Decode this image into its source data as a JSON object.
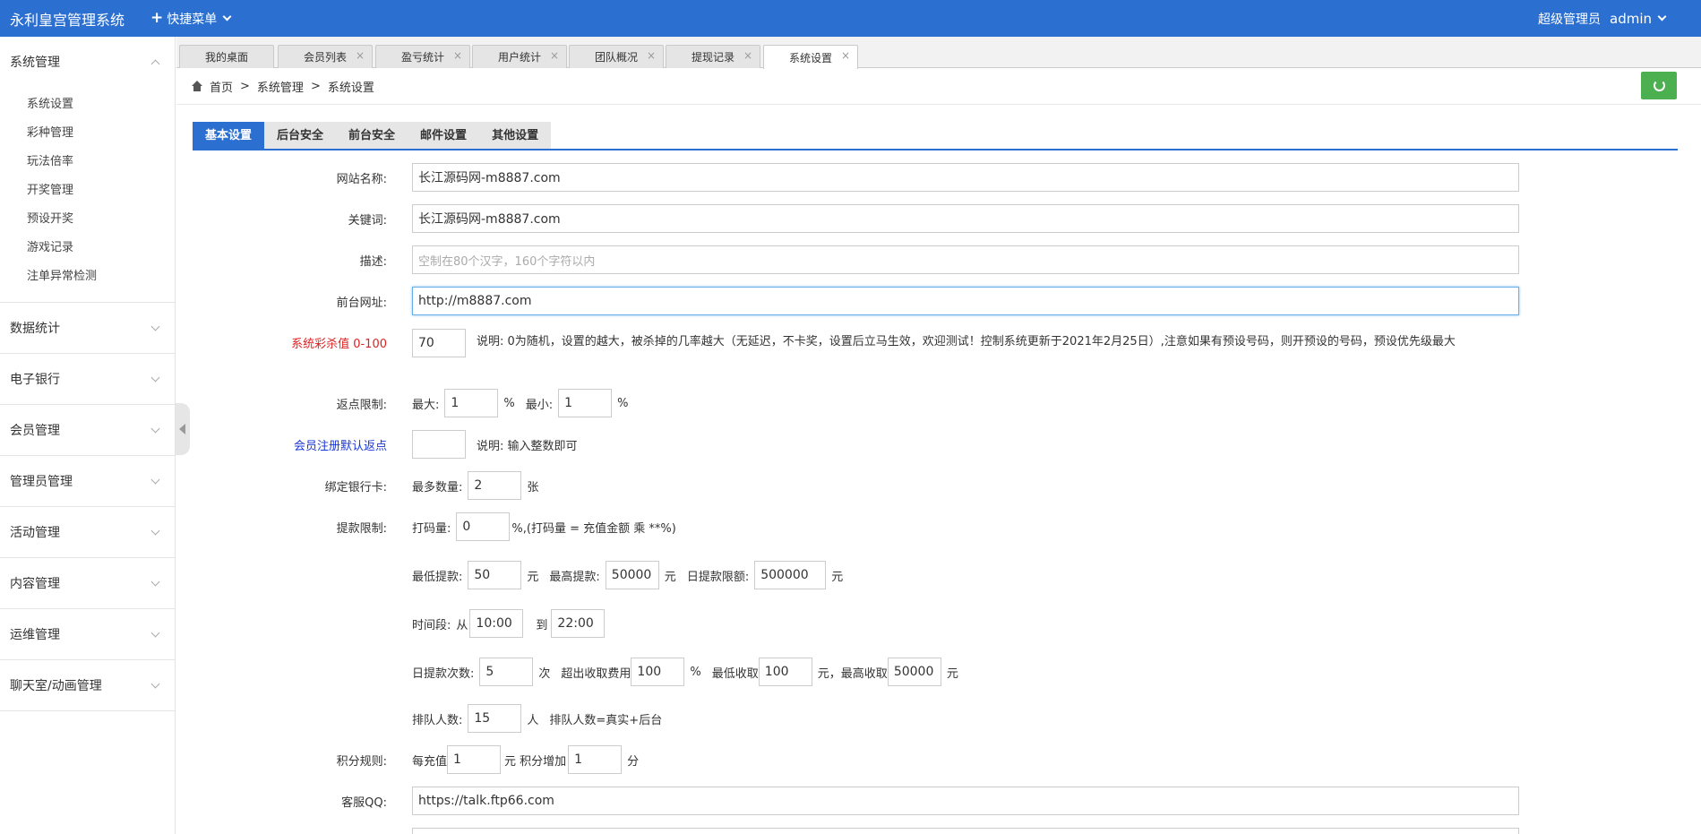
{
  "header": {
    "title": "永利皇宫管理系统",
    "quick_menu": "快捷菜单",
    "role": "超级管理员",
    "user": "admin"
  },
  "sidebar": {
    "groups": [
      {
        "label": "系统管理",
        "items": [
          "系统设置",
          "彩种管理",
          "玩法倍率",
          "开奖管理",
          "预设开奖",
          "游戏记录",
          "注单异常检测"
        ]
      },
      {
        "label": "数据统计"
      },
      {
        "label": "电子银行"
      },
      {
        "label": "会员管理"
      },
      {
        "label": "管理员管理"
      },
      {
        "label": "活动管理"
      },
      {
        "label": "内容管理"
      },
      {
        "label": "运维管理"
      },
      {
        "label": "聊天室/动画管理"
      }
    ]
  },
  "page_tabs": [
    "我的桌面",
    "会员列表",
    "盈亏统计",
    "用户统计",
    "团队概况",
    "提现记录",
    "系统设置"
  ],
  "breadcrumb": [
    "首页",
    ">",
    "系统管理",
    ">",
    "系统设置"
  ],
  "settings_tabs": [
    "基本设置",
    "后台安全",
    "前台安全",
    "邮件设置",
    "其他设置"
  ],
  "form": {
    "site_name": {
      "label": "网站名称:",
      "value": "长江源码网-m8887.com"
    },
    "keywords": {
      "label": "关键词:",
      "value": "长江源码网-m8887.com"
    },
    "description": {
      "label": "描述:",
      "placeholder": "空制在80个汉字，160个字符以内"
    },
    "front_url": {
      "label": "前台网址:",
      "value": "http://m8887.com"
    },
    "kill_rate": {
      "label": "系统彩杀值 0-100",
      "value": "70",
      "note": "说明:  0为随机，设置的越大，被杀掉的几率越大（无延迟，不卡奖，设置后立马生效，欢迎测试！控制系统更新于2021年2月25日）,注意如果有预设号码，则开预设的号码，预设优先级最大"
    },
    "rebate": {
      "label": "返点限制:",
      "max_label": "最大:",
      "max": "1",
      "min_label": "最小:",
      "min": "1",
      "unit": "%"
    },
    "reg_rebate": {
      "label": "会员注册默认返点",
      "value": "",
      "note": "说明:  输入整数即可"
    },
    "bank_card": {
      "label": "绑定银行卡:",
      "max_label": "最多数量:",
      "max": "2",
      "unit": "张"
    },
    "withdraw": {
      "label": "提款限制:",
      "bet_label": "打码量:",
      "bet": "0",
      "bet_note": "%,(打码量 = 充值金额 乘 **%)",
      "min_label": "最低提款:",
      "min": "50",
      "max_label": "最高提款:",
      "max": "50000",
      "daily_label": "日提款限额:",
      "daily": "500000",
      "yuan": "元",
      "time_label": "时间段:",
      "from_label": "从",
      "from": "10:00",
      "to_label": "到",
      "to": "22:00",
      "times_label": "日提款次数:",
      "times": "5",
      "times_unit": "次",
      "fee_label": "超出收取费用",
      "fee": "100",
      "pct": "%",
      "fee_min_label": "最低收取",
      "fee_min": "100",
      "yuan_comma": "元，最高收取",
      "fee_max": "50000",
      "queue_label": "排队人数:",
      "queue": "15",
      "queue_unit": "人",
      "queue_note": "排队人数=真实+后台"
    },
    "points": {
      "label": "积分规则:",
      "per_label": "每充值",
      "per": "1",
      "add_label": "元 积分增加",
      "add": "1",
      "unit": "分"
    },
    "qq": {
      "label": "客服QQ:",
      "value": "https://talk.ftp66.com"
    }
  }
}
